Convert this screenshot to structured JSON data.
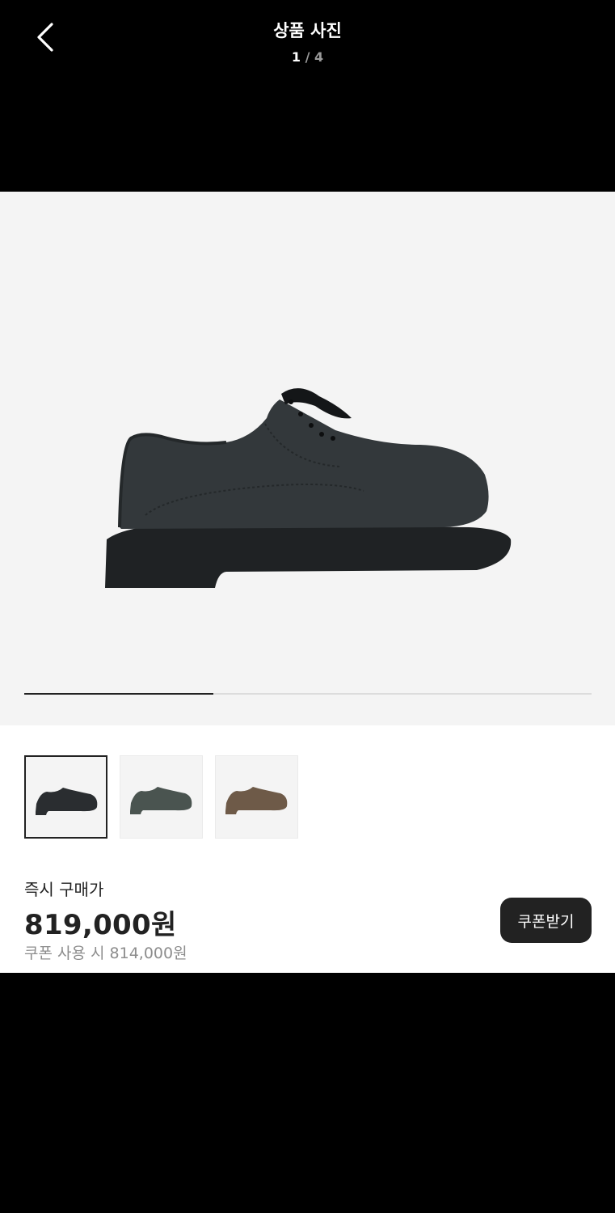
{
  "header": {
    "title": "상품 사진",
    "current_page": "1",
    "separator": " / ",
    "total_pages": "4",
    "back_icon": "chevron-left-icon"
  },
  "gallery": {
    "progress_fraction": 0.333,
    "thumbnails": [
      {
        "label": "black shoe",
        "color": "#2a2d30",
        "selected": true
      },
      {
        "label": "grey shoe",
        "color": "#4a5450",
        "selected": false
      },
      {
        "label": "brown shoe",
        "color": "#6e5a48",
        "selected": false
      }
    ]
  },
  "price": {
    "label": "즉시 구매가",
    "amount": "819,000원",
    "coupon_text": "쿠폰 사용 시 814,000원",
    "coupon_button": "쿠폰받기"
  },
  "colors": {
    "background": "#000000",
    "hero_background": "#f4f4f4",
    "accent_dark": "#222222"
  }
}
